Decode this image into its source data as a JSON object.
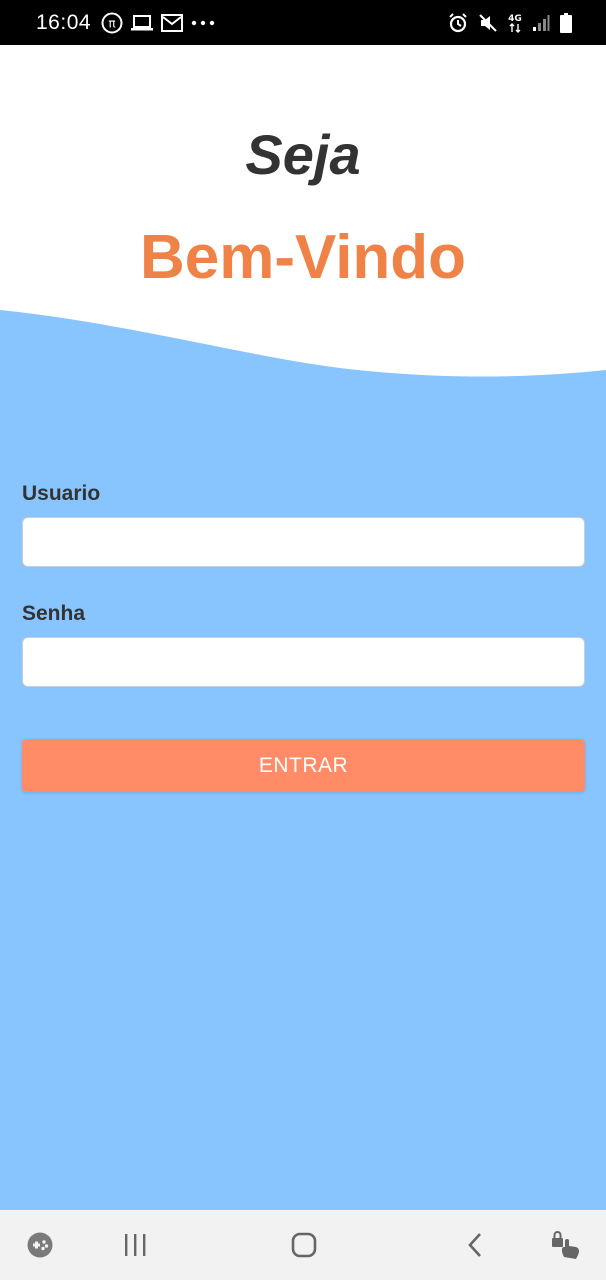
{
  "status_bar": {
    "time": "16:04",
    "left_icons": [
      "pi-icon",
      "laptop-icon",
      "gmail-icon",
      "more-icon"
    ],
    "right_icons": [
      "alarm-icon",
      "mute-icon",
      "network-4g-icon",
      "signal-icon",
      "battery-icon"
    ],
    "network_label": "4G"
  },
  "header": {
    "greeting": "Seja",
    "welcome": "Bem-Vindo"
  },
  "form": {
    "username_label": "Usuario",
    "username_value": "",
    "password_label": "Senha",
    "password_value": "",
    "submit_label": "ENTRAR"
  },
  "nav_bar": {
    "items": [
      "game-launcher-icon",
      "recents-icon",
      "home-icon",
      "back-icon",
      "screen-lock-icon"
    ]
  },
  "colors": {
    "accent_orange": "#ee8247",
    "button": "#ff8c66",
    "background_blue": "#88c4fd",
    "title_dark": "#333333"
  }
}
